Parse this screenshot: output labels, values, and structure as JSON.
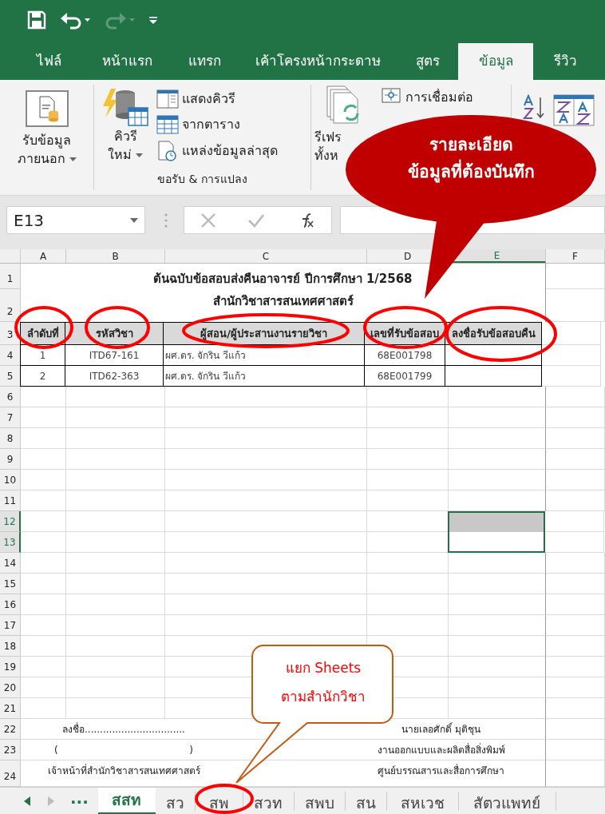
{
  "tabs": [
    {
      "label": "ไฟล์",
      "selected": false
    },
    {
      "label": "หน้าแรก",
      "selected": false
    },
    {
      "label": "แทรก",
      "selected": false
    },
    {
      "label": "เค้าโครงหน้ากระดาษ",
      "selected": false
    },
    {
      "label": "สูตร",
      "selected": false
    },
    {
      "label": "ข้อมูล",
      "selected": true
    },
    {
      "label": "รีวิว",
      "selected": false
    }
  ],
  "ribbon": {
    "external_data": [
      "รับข้อมูล",
      "ภายนอก"
    ],
    "new_query": [
      "คิวรี",
      "ใหม่"
    ],
    "query_items": [
      "แสดงคิวรี",
      "จากตาราง",
      "แหล่งข้อมูลล่าสุด"
    ],
    "group_label": "ขอรับ & การแปลง",
    "refresh": [
      "รีเฟร",
      "ทั้งห"
    ],
    "connections": "การเชื่อมต่อ"
  },
  "name_box": "E13",
  "columns": [
    {
      "label": "A",
      "selected": false
    },
    {
      "label": "B",
      "selected": false
    },
    {
      "label": "C",
      "selected": false
    },
    {
      "label": "D",
      "selected": false
    },
    {
      "label": "E",
      "selected": true
    },
    {
      "label": "F",
      "selected": false
    }
  ],
  "rows": [
    {
      "number": "1",
      "kind": "title",
      "selected": false,
      "text": "ต้นฉบับข้อสอบส่งคืนอาจารย์ ปีการศึกษา 1/2568"
    },
    {
      "number": "2",
      "kind": "title",
      "selected": false,
      "text": "สำนักวิชาสารสนเทศศาสตร์"
    },
    {
      "number": "3",
      "kind": "header",
      "selected": false,
      "cells": [
        "ลำดับที่",
        "รหัสวิชา",
        "ผู้สอน/ผู้ประสานงานรายวิชา",
        "เลขที่รับข้อสอบ",
        "ลงชื่อรับข้อสอบคืน"
      ]
    },
    {
      "number": "4",
      "kind": "data",
      "selected": false,
      "cells": [
        "1",
        "ITD67-161",
        "ผศ.ดร. จักริน วีแก้ว",
        "68E001798"
      ]
    },
    {
      "number": "5",
      "kind": "data",
      "selected": false,
      "cells": [
        "2",
        "ITD62-363",
        "ผศ.ดร. จักริน วีแก้ว",
        "68E001799"
      ]
    },
    {
      "number": "6",
      "kind": "empty",
      "selected": false
    },
    {
      "number": "7",
      "kind": "empty",
      "selected": false
    },
    {
      "number": "8",
      "kind": "empty",
      "selected": false
    },
    {
      "number": "9",
      "kind": "empty",
      "selected": false
    },
    {
      "number": "10",
      "kind": "empty",
      "selected": false
    },
    {
      "number": "11",
      "kind": "empty",
      "selected": false
    },
    {
      "number": "12",
      "kind": "empty",
      "selected": true
    },
    {
      "number": "13",
      "kind": "empty",
      "selected": true
    },
    {
      "number": "14",
      "kind": "empty",
      "selected": false
    },
    {
      "number": "15",
      "kind": "empty",
      "selected": false
    },
    {
      "number": "16",
      "kind": "empty",
      "selected": false
    },
    {
      "number": "17",
      "kind": "empty",
      "selected": false
    },
    {
      "number": "18",
      "kind": "empty",
      "selected": false
    },
    {
      "number": "19",
      "kind": "empty",
      "selected": false
    },
    {
      "number": "20",
      "kind": "empty",
      "selected": false
    },
    {
      "number": "21",
      "kind": "empty",
      "selected": false
    },
    {
      "number": "22",
      "kind": "signature",
      "selected": false,
      "left": "ลงชื่อ.................................",
      "right": "นายเลอศักดิ์  มุติชุน"
    },
    {
      "number": "23",
      "kind": "signature",
      "selected": false,
      "left": "(",
      "left_end": ")",
      "right": "งานออกแบบและผลิตสื่อสิ่งพิมพ์"
    },
    {
      "number": "24",
      "kind": "signature",
      "selected": false,
      "left": "เจ้าหน้าที่สำนักวิชาสารสนเทศศาสตร์",
      "right": "ศูนย์บรรณสารและสื่อการศึกษา"
    }
  ],
  "sheet_nav": "...",
  "sheet_tabs": [
    {
      "label": "สสท",
      "selected": true
    },
    {
      "label": "สว",
      "selected": false
    },
    {
      "label": "สพ",
      "selected": false
    },
    {
      "label": "สวท",
      "selected": false
    },
    {
      "label": "สพบ",
      "selected": false
    },
    {
      "label": "สน",
      "selected": false
    },
    {
      "label": "สหเวช",
      "selected": false
    },
    {
      "label": "สัตวแพทย์",
      "selected": false
    }
  ],
  "callouts": [
    {
      "kind": "ellipse",
      "lines": [
        "รายละเอียด",
        "ข้อมูลที่ต้องบันทึก"
      ]
    },
    {
      "kind": "box",
      "lines": [
        "แยก Sheets",
        "ตามสำนักวิชา"
      ]
    }
  ]
}
